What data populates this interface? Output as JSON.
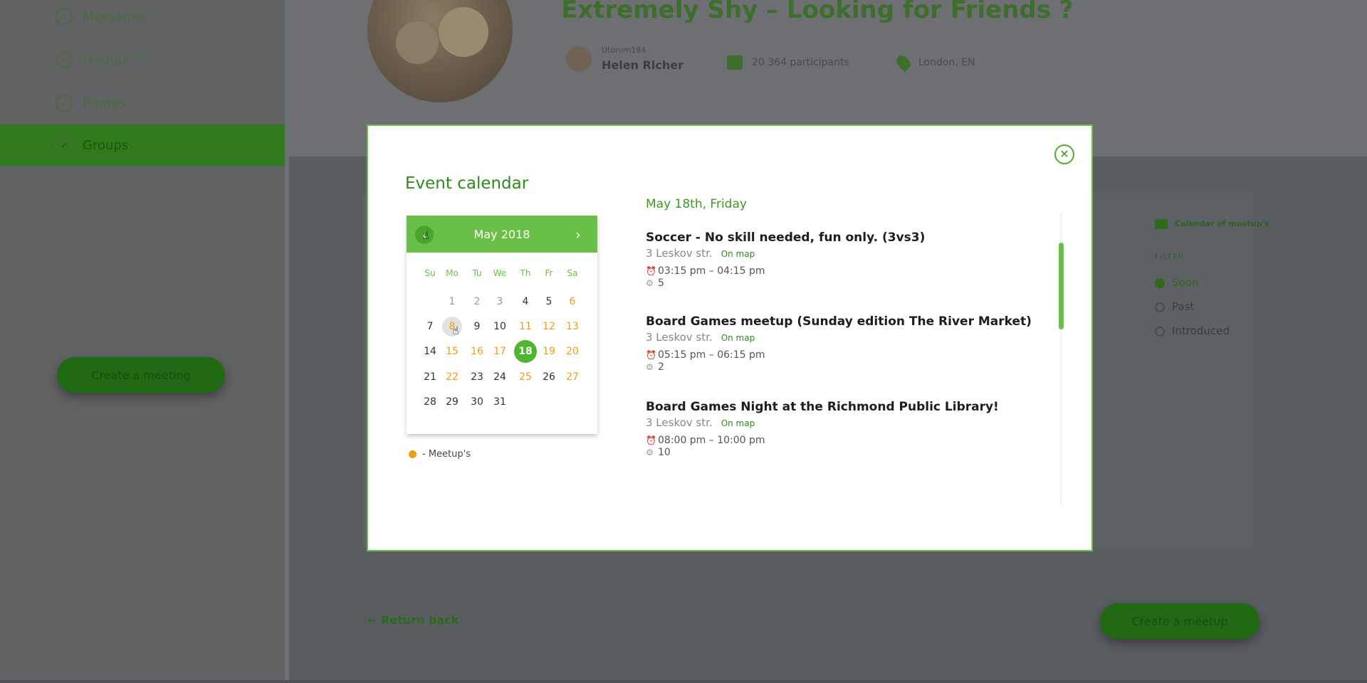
{
  "background": {
    "sidebar": {
      "items": [
        {
          "label": "Messages",
          "badge": "17",
          "icon": "chat-icon"
        },
        {
          "label": "Friends",
          "badge": "129",
          "icon": "users-icon"
        },
        {
          "label": "Photos",
          "badge": "",
          "icon": "photo-icon"
        },
        {
          "label": "Groups",
          "badge": "",
          "icon": "groups-icon"
        }
      ],
      "create_button": "Create a meeting"
    },
    "group": {
      "title": "Extremely Shy – Looking for Friends ?",
      "author_label": "Utorum184",
      "author_name": "Helen Richer",
      "participants": "20 364 participants",
      "location": "London, EN"
    },
    "right_panel": {
      "calendar_label": "Calendar of meetup's",
      "filter_label": "FILTER",
      "filters": [
        "Soon",
        "Past",
        "Introduced"
      ]
    },
    "return_back": "Return back",
    "create_button": "Create a meetup"
  },
  "modal": {
    "title": "Event calendar",
    "close_icon": "close-icon",
    "calendar": {
      "month_label": "May 2018",
      "weekdays": [
        "Su",
        "Mo",
        "Tu",
        "We",
        "Th",
        "Fr",
        "Sa"
      ],
      "days": [
        {
          "day": "1",
          "state": "inactive"
        },
        {
          "day": "2",
          "state": "inactive"
        },
        {
          "day": "3",
          "state": "inactive"
        },
        {
          "day": "4",
          "state": "normal"
        },
        {
          "day": "5",
          "state": "normal"
        },
        {
          "day": "6",
          "state": "meetup"
        },
        {
          "day": "7",
          "state": "normal"
        },
        {
          "day": "8",
          "state": "hover"
        },
        {
          "day": "9",
          "state": "normal"
        },
        {
          "day": "10",
          "state": "normal"
        },
        {
          "day": "11",
          "state": "meetup"
        },
        {
          "day": "12",
          "state": "meetup"
        },
        {
          "day": "13",
          "state": "meetup"
        },
        {
          "day": "14",
          "state": "normal"
        },
        {
          "day": "15",
          "state": "meetup"
        },
        {
          "day": "16",
          "state": "meetup"
        },
        {
          "day": "17",
          "state": "meetup"
        },
        {
          "day": "18",
          "state": "selected"
        },
        {
          "day": "19",
          "state": "meetup"
        },
        {
          "day": "20",
          "state": "meetup"
        },
        {
          "day": "21",
          "state": "normal"
        },
        {
          "day": "22",
          "state": "meetup"
        },
        {
          "day": "23",
          "state": "normal"
        },
        {
          "day": "24",
          "state": "normal"
        },
        {
          "day": "25",
          "state": "meetup"
        },
        {
          "day": "26",
          "state": "normal"
        },
        {
          "day": "27",
          "state": "meetup"
        },
        {
          "day": "28",
          "state": "normal"
        },
        {
          "day": "29",
          "state": "normal"
        },
        {
          "day": "30",
          "state": "normal"
        },
        {
          "day": "31",
          "state": "normal"
        }
      ],
      "legend": "- Meetup's"
    },
    "events_date": "May 18th, Friday",
    "events": [
      {
        "title": "Soccer - No skill needed, fun only. (3vs3)",
        "address": "3 Leskov str.",
        "map_link": "On map",
        "time": "03:15 pm – 04:15 pm",
        "count": "5"
      },
      {
        "title": "Board Games meetup (Sunday edition The River Market)",
        "address": "3 Leskov str.",
        "map_link": "On map",
        "time": "05:15 pm – 06:15 pm",
        "count": "2"
      },
      {
        "title": "Board Games Night at the Richmond Public Library!",
        "address": "3 Leskov str.",
        "map_link": "On map",
        "time": "08:00 pm – 10:00 pm",
        "count": "10"
      }
    ]
  },
  "colors": {
    "accent": "#6ac047",
    "accent_dark": "#2f8a1c",
    "meetup": "#f39c12",
    "overlay": "#5f6166"
  }
}
